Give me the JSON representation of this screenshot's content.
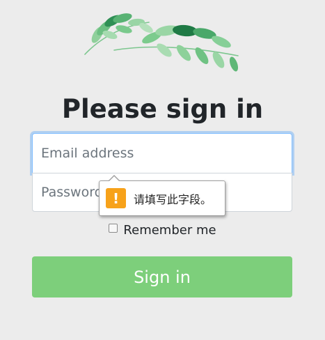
{
  "form": {
    "title": "Please sign in",
    "email_placeholder": "Email address",
    "password_placeholder": "Password",
    "remember_label": "Remember me",
    "submit_label": "Sign in"
  },
  "validation_tooltip": {
    "icon": "warning-icon",
    "message": "请填写此字段。",
    "icon_glyph": "!"
  },
  "logo": {
    "icon": "leaf-branch-icon"
  },
  "colors": {
    "background": "#ececec",
    "submit": "#7dcf7b",
    "focus_border": "#80bdff",
    "warning": "#f7a21a",
    "leaf": "#5fb777"
  }
}
